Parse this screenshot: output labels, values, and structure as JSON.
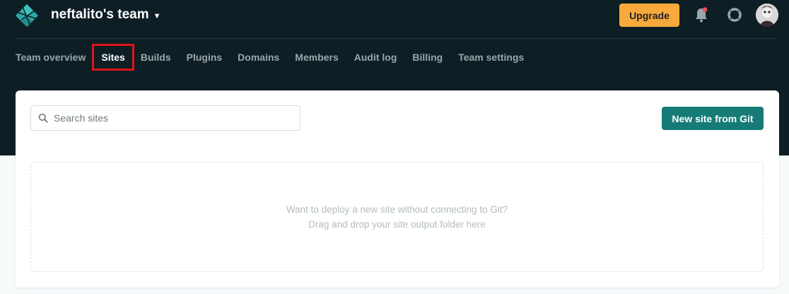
{
  "header": {
    "team_name": "neftalito's team",
    "upgrade_label": "Upgrade",
    "logo_icon": "netlify-logo-icon",
    "notification_icon": "bell-icon",
    "help_icon": "lifebuoy-icon",
    "avatar_icon": "user-avatar"
  },
  "nav": {
    "items": [
      {
        "label": "Team overview"
      },
      {
        "label": "Sites"
      },
      {
        "label": "Builds"
      },
      {
        "label": "Plugins"
      },
      {
        "label": "Domains"
      },
      {
        "label": "Members"
      },
      {
        "label": "Audit log"
      },
      {
        "label": "Billing"
      },
      {
        "label": "Team settings"
      }
    ],
    "active": "Sites"
  },
  "main": {
    "search": {
      "placeholder": "Search sites",
      "value": ""
    },
    "new_site_label": "New site from Git",
    "dropzone": {
      "line1": "Want to deploy a new site without connecting to Git?",
      "line2": "Drag and drop your site output folder here"
    }
  },
  "colors": {
    "header_bg": "#0e1e25",
    "upgrade_bg": "#f7a93b",
    "primary_button": "#167b77",
    "highlight_box": "#e0141b",
    "notification_dot": "#f04f55"
  }
}
